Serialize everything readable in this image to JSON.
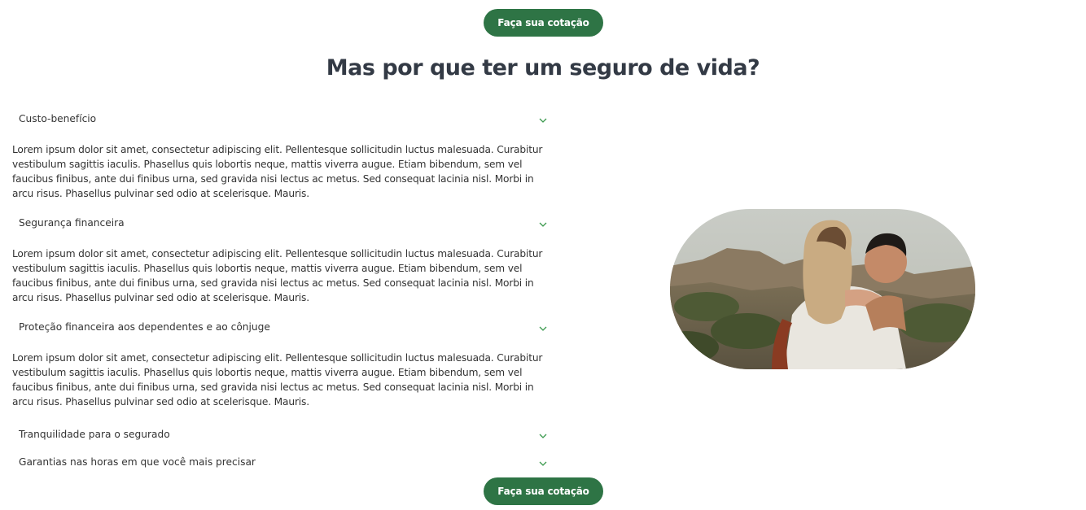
{
  "cta": {
    "top_label": "Faça sua cotação",
    "bottom_label": "Faça sua cotação"
  },
  "section": {
    "title": "Mas por que ter um seguro de vida?"
  },
  "accordion": {
    "items": [
      {
        "title": "Custo-benefício",
        "body": "Lorem ipsum dolor sit amet, consectetur adipiscing elit. Pellentesque sollicitudin luctus malesuada. Curabitur vestibulum sagittis iaculis. Phasellus quis lobortis neque, mattis viverra augue. Etiam bibendum, sem vel faucibus finibus, ante dui finibus urna, sed gravida nisi lectus ac metus. Sed consequat lacinia nisl. Morbi in arcu risus. Phasellus pulvinar sed odio at scelerisque. Mauris."
      },
      {
        "title": "Segurança financeira",
        "body": "Lorem ipsum dolor sit amet, consectetur adipiscing elit. Pellentesque sollicitudin luctus malesuada. Curabitur vestibulum sagittis iaculis. Phasellus quis lobortis neque, mattis viverra augue. Etiam bibendum, sem vel faucibus finibus, ante dui finibus urna, sed gravida nisi lectus ac metus. Sed consequat lacinia nisl. Morbi in arcu risus. Phasellus pulvinar sed odio at scelerisque. Mauris."
      },
      {
        "title": "Proteção financeira aos dependentes e ao cônjuge",
        "body": "Lorem ipsum dolor sit amet, consectetur adipiscing elit. Pellentesque sollicitudin luctus malesuada. Curabitur vestibulum sagittis iaculis. Phasellus quis lobortis neque, mattis viverra augue. Etiam bibendum, sem vel faucibus finibus, ante dui finibus urna, sed gravida nisi lectus ac metus. Sed consequat lacinia nisl. Morbi in arcu risus. Phasellus pulvinar sed odio at scelerisque. Mauris."
      },
      {
        "title": "Tranquilidade para o segurado"
      },
      {
        "title": "Garantias nas horas em que você mais precisar"
      }
    ],
    "chevron_icon": "chevron-down-icon",
    "chevron_color": "#3c9a4f"
  },
  "colors": {
    "button": "#2e7445",
    "title": "#333a45",
    "text": "#333333"
  },
  "image": {
    "subject": "couple-photo"
  }
}
